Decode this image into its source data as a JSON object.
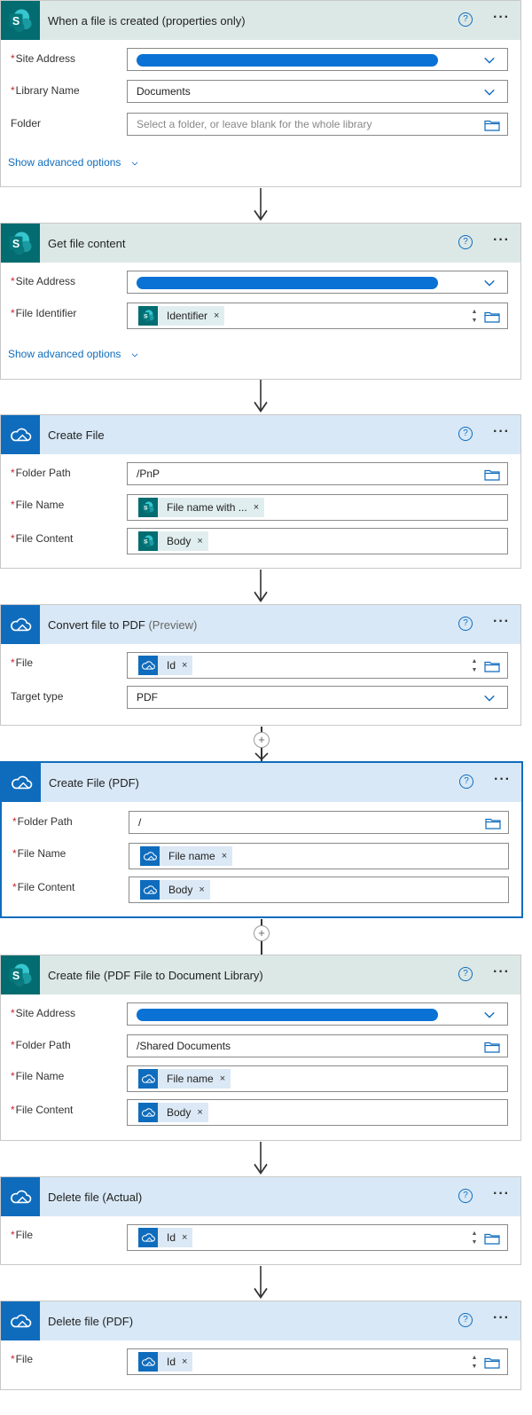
{
  "colors": {
    "sharepoint": "#036c70",
    "onedrive": "#0f6cbd",
    "required": "#c4262e",
    "link": "#0f6cbd"
  },
  "icons": {
    "sharepoint": "sharepoint-icon",
    "onedrive": "onedrive-cloud-icon",
    "help": "help-circle-icon",
    "more": "more-ellipsis-icon",
    "chevron": "chevron-down-icon",
    "folder": "folder-icon",
    "remove": "close-icon"
  },
  "common": {
    "help": "?",
    "more": "···",
    "token_remove": "×",
    "req": "*"
  },
  "cards": [
    {
      "title": "When a file is created (properties only)",
      "fields": [
        {
          "label": "Site Address"
        },
        {
          "label": "Library Name",
          "value": "Documents"
        },
        {
          "label": "Folder",
          "placeholder": "Select a folder, or leave blank for the whole library"
        }
      ],
      "advanced": "Show advanced options"
    },
    {
      "title": "Get file content",
      "fields": [
        {
          "label": "Site Address"
        },
        {
          "label": "File Identifier",
          "token": "Identifier"
        }
      ],
      "advanced": "Show advanced options"
    },
    {
      "title": "Create File",
      "fields": [
        {
          "label": "Folder Path",
          "value": "/PnP"
        },
        {
          "label": "File Name",
          "token": "File name with ..."
        },
        {
          "label": "File Content",
          "token": "Body"
        }
      ]
    },
    {
      "title": "Convert file to PDF",
      "title_suffix": "(Preview)",
      "fields": [
        {
          "label": "File",
          "token": "Id"
        },
        {
          "label": "Target type",
          "value": "PDF"
        }
      ]
    },
    {
      "title": "Create File (PDF)",
      "fields": [
        {
          "label": "Folder Path",
          "value": "/"
        },
        {
          "label": "File Name",
          "token": "File name"
        },
        {
          "label": "File Content",
          "token": "Body"
        }
      ]
    },
    {
      "title": "Create file (PDF File to Document Library)",
      "fields": [
        {
          "label": "Site Address"
        },
        {
          "label": "Folder Path",
          "value": "/Shared Documents"
        },
        {
          "label": "File Name",
          "token": "File name"
        },
        {
          "label": "File Content",
          "token": "Body"
        }
      ]
    },
    {
      "title": "Delete file (Actual)",
      "fields": [
        {
          "label": "File",
          "token": "Id"
        }
      ]
    },
    {
      "title": "Delete file (PDF)",
      "fields": [
        {
          "label": "File",
          "token": "Id"
        }
      ]
    }
  ]
}
